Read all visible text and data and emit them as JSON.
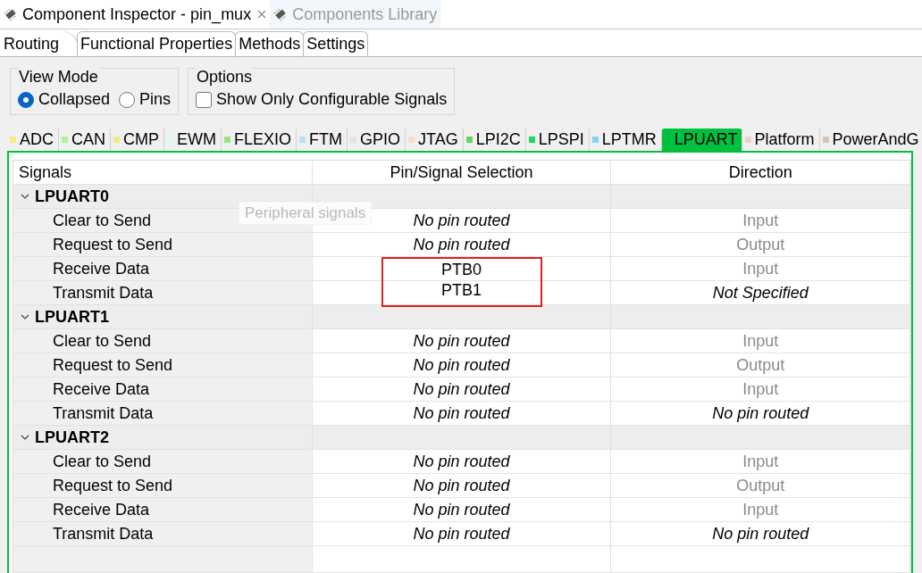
{
  "view_tabs": [
    {
      "label": "Component Inspector - pin_mux",
      "selected": true,
      "closable": true
    },
    {
      "label": "Components Library",
      "selected": false,
      "closable": false
    }
  ],
  "editor_tabs": [
    {
      "label": "Routing",
      "selected": true
    },
    {
      "label": "Functional Properties",
      "selected": false
    },
    {
      "label": "Methods",
      "selected": false
    },
    {
      "label": "Settings",
      "selected": false
    }
  ],
  "view_mode": {
    "title": "View Mode",
    "options": [
      {
        "label": "Collapsed",
        "selected": true
      },
      {
        "label": "Pins",
        "selected": false
      }
    ]
  },
  "options": {
    "title": "Options",
    "checkboxes": [
      {
        "label": "Show Only Configurable Signals",
        "checked": false
      }
    ]
  },
  "peripheral_tabs": [
    {
      "label": "ADC",
      "color": "#f4f07c",
      "selected": false
    },
    {
      "label": "CAN",
      "color": "#b4f094",
      "selected": false
    },
    {
      "label": "CMP",
      "color": "#f0ec84",
      "selected": false
    },
    {
      "label": "EWM",
      "color": "#d8f8f8",
      "selected": false
    },
    {
      "label": "FLEXIO",
      "color": "#94e47c",
      "selected": false
    },
    {
      "label": "FTM",
      "color": "#b4e0f8",
      "selected": false
    },
    {
      "label": "GPIO",
      "color": "#f0dcf0",
      "selected": false
    },
    {
      "label": "JTAG",
      "color": "#f8dcc4",
      "selected": false
    },
    {
      "label": "LPI2C",
      "color": "#64d864",
      "selected": false
    },
    {
      "label": "LPSPI",
      "color": "#24d45c",
      "selected": false
    },
    {
      "label": "LPTMR",
      "color": "#84d4f8",
      "selected": false
    },
    {
      "label": "LPUART",
      "color": "#00c040",
      "selected": true
    },
    {
      "label": "Platform",
      "color": "#ecd4c4",
      "selected": false
    },
    {
      "label": "PowerAndG",
      "color": "#dcc4b4",
      "selected": false
    }
  ],
  "table": {
    "columns": [
      "Signals",
      "Pin/Signal Selection",
      "Direction"
    ],
    "tooltip": "Peripheral signals",
    "groups": [
      {
        "name": "LPUART0",
        "expanded": true,
        "rows": [
          {
            "signal": "Clear to Send",
            "selection": {
              "text": "No pin routed",
              "kind": "unset",
              "highlighted": false
            },
            "direction": {
              "text": "Input",
              "kind": "default"
            }
          },
          {
            "signal": "Request to Send",
            "selection": {
              "text": "No pin routed",
              "kind": "unset",
              "highlighted": false
            },
            "direction": {
              "text": "Output",
              "kind": "default"
            }
          },
          {
            "signal": "Receive Data",
            "selection": {
              "text": "PTB0",
              "kind": "set",
              "highlighted": true
            },
            "direction": {
              "text": "Input",
              "kind": "default"
            }
          },
          {
            "signal": "Transmit Data",
            "selection": {
              "text": "PTB1",
              "kind": "set",
              "highlighted": true
            },
            "direction": {
              "text": "Not Specified",
              "kind": "unset"
            }
          }
        ]
      },
      {
        "name": "LPUART1",
        "expanded": true,
        "rows": [
          {
            "signal": "Clear to Send",
            "selection": {
              "text": "No pin routed",
              "kind": "unset",
              "highlighted": false
            },
            "direction": {
              "text": "Input",
              "kind": "default"
            }
          },
          {
            "signal": "Request to Send",
            "selection": {
              "text": "No pin routed",
              "kind": "unset",
              "highlighted": false
            },
            "direction": {
              "text": "Output",
              "kind": "default"
            }
          },
          {
            "signal": "Receive Data",
            "selection": {
              "text": "No pin routed",
              "kind": "unset",
              "highlighted": false
            },
            "direction": {
              "text": "Input",
              "kind": "default"
            }
          },
          {
            "signal": "Transmit Data",
            "selection": {
              "text": "No pin routed",
              "kind": "unset",
              "highlighted": false
            },
            "direction": {
              "text": "No pin routed",
              "kind": "unset"
            }
          }
        ]
      },
      {
        "name": "LPUART2",
        "expanded": true,
        "rows": [
          {
            "signal": "Clear to Send",
            "selection": {
              "text": "No pin routed",
              "kind": "unset",
              "highlighted": false
            },
            "direction": {
              "text": "Input",
              "kind": "default"
            }
          },
          {
            "signal": "Request to Send",
            "selection": {
              "text": "No pin routed",
              "kind": "unset",
              "highlighted": false
            },
            "direction": {
              "text": "Output",
              "kind": "default"
            }
          },
          {
            "signal": "Receive Data",
            "selection": {
              "text": "No pin routed",
              "kind": "unset",
              "highlighted": false
            },
            "direction": {
              "text": "Input",
              "kind": "default"
            }
          },
          {
            "signal": "Transmit Data",
            "selection": {
              "text": "No pin routed",
              "kind": "unset",
              "highlighted": false
            },
            "direction": {
              "text": "No pin routed",
              "kind": "unset"
            }
          }
        ]
      }
    ]
  }
}
